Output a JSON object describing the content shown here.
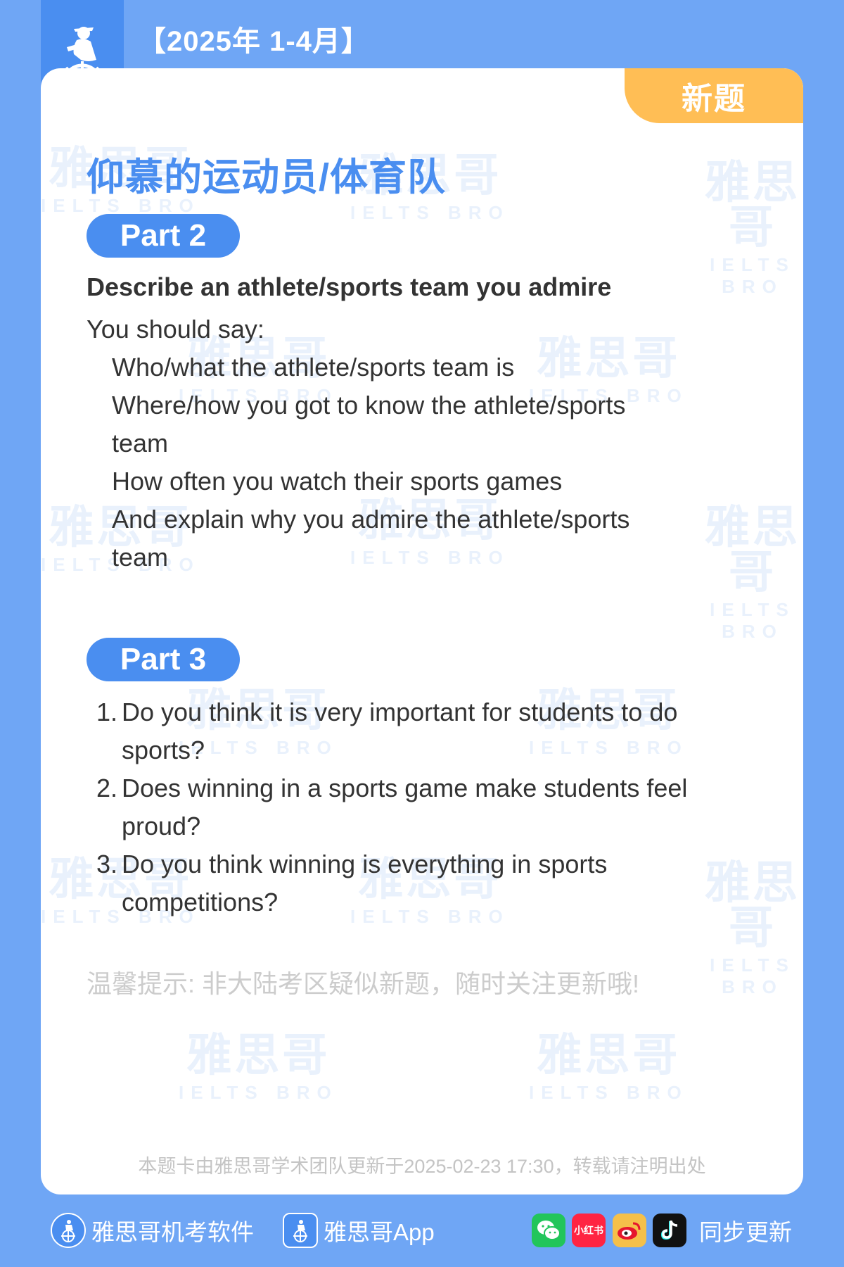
{
  "header": {
    "period": "【2025年 1-4月】"
  },
  "card": {
    "tag": "新题",
    "title": "仰慕的运动员/体育队",
    "part2": {
      "label": "Part 2",
      "heading": "Describe an athlete/sports team you admire",
      "intro": "You should say:",
      "cues": [
        "Who/what the athlete/sports team is",
        "Where/how you got to know the athlete/sports",
        "team",
        "How often you watch their sports games",
        "And explain why you admire the athlete/sports",
        "team"
      ]
    },
    "part3": {
      "label": "Part 3",
      "questions": [
        {
          "num": "1.",
          "lines": [
            "Do you think it is very important for students to do",
            "sports?"
          ]
        },
        {
          "num": "2.",
          "lines": [
            "Does winning in a sports game make students feel",
            "proud?"
          ]
        },
        {
          "num": "3.",
          "lines": [
            "Do you think winning is everything in sports",
            "competitions?"
          ]
        }
      ]
    },
    "tip": "温馨提示: 非大陆考区疑似新题，随时关注更新哦!",
    "footnote": "本题卡由雅思哥学术团队更新于2025-02-23 17:30，转载请注明出处",
    "watermark": {
      "cn": "雅思哥",
      "en": "IELTS BRO"
    }
  },
  "bottom": {
    "software": "雅思哥机考软件",
    "app": "雅思哥App",
    "sync": "同步更新",
    "xiaohongshu": "小红书"
  },
  "colors": {
    "background": "#6fa6f5",
    "accent": "#4a8ef0",
    "tag": "#ffbe55"
  },
  "icons": [
    "helmsman-logo",
    "wechat-icon",
    "xiaohongshu-icon",
    "weibo-icon",
    "douyin-icon"
  ]
}
